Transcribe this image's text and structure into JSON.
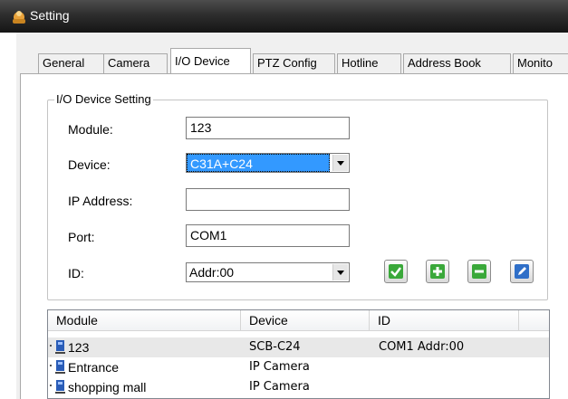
{
  "window": {
    "title": "Setting"
  },
  "tabs": [
    {
      "label": "General"
    },
    {
      "label": "Camera"
    },
    {
      "label": "I/O Device"
    },
    {
      "label": "PTZ Config"
    },
    {
      "label": "Hotline"
    },
    {
      "label": "Address Book"
    },
    {
      "label": "Monito"
    }
  ],
  "active_tab": "I/O Device",
  "group": {
    "title": "I/O Device Setting",
    "module_label": "Module:",
    "module_value": "123",
    "device_label": "Device:",
    "device_value": "C31A+C24",
    "ip_label": "IP Address:",
    "ip_value": "",
    "port_label": "Port:",
    "port_value": "COM1",
    "id_label": "ID:",
    "id_value": "Addr:00"
  },
  "action_buttons": [
    "check-icon",
    "plus-icon",
    "minus-icon",
    "edit-icon"
  ],
  "colors": {
    "check": "#3aa83a",
    "plus": "#3aa83a",
    "minus": "#3aa83a",
    "edit": "#2f6fc8",
    "selection": "#3399ff"
  },
  "list": {
    "columns": [
      "Module",
      "Device",
      "ID"
    ],
    "rows": [
      {
        "module": "123",
        "device": "SCB-C24",
        "id": "COM1 Addr:00",
        "selected": true
      },
      {
        "module": "Entrance",
        "device": "IP Camera",
        "id": ""
      },
      {
        "module": "shopping mall",
        "device": "IP Camera",
        "id": ""
      }
    ]
  }
}
